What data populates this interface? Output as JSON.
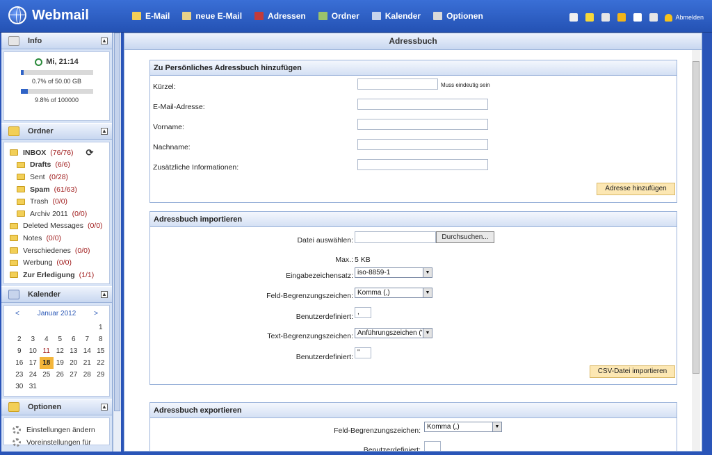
{
  "app": {
    "title": "Webmail"
  },
  "nav": [
    {
      "label": "E-Mail",
      "icon": "mail-icon",
      "color": "#f2cf57"
    },
    {
      "label": "neue E-Mail",
      "icon": "compose-icon",
      "color": "#e8d28a"
    },
    {
      "label": "Adressen",
      "icon": "addressbook-icon",
      "color": "#c23b3b"
    },
    {
      "label": "Ordner",
      "icon": "folder-icon",
      "color": "#9bc36b"
    },
    {
      "label": "Kalender",
      "icon": "calendar-icon",
      "color": "#c7d4ec"
    },
    {
      "label": "Optionen",
      "icon": "options-gear-icon",
      "color": "#d9d9d9"
    }
  ],
  "tools": [
    {
      "icon": "notes-icon",
      "color": "#f0f0f0"
    },
    {
      "icon": "sticky-note-icon",
      "color": "#f6d83a"
    },
    {
      "icon": "card-icon",
      "color": "#e6e6e6"
    },
    {
      "icon": "favorites-icon",
      "color": "#f2b51a"
    },
    {
      "icon": "help-icon",
      "color": "#ffffff"
    },
    {
      "icon": "search-icon",
      "color": "#e6e6e6"
    }
  ],
  "logout": "Abmelden",
  "sidebar": {
    "info": {
      "title": "Info",
      "time": "Mi, 21:14",
      "quota1": "0.7% of 50.00 GB",
      "quota1_pct": 0.7,
      "quota2": "9.8% of 100000",
      "quota2_pct": 9.8
    },
    "folders_title": "Ordner",
    "folders": [
      {
        "name": "INBOX",
        "count": "(76/76)",
        "bold": true
      },
      {
        "name": "Drafts",
        "count": "(6/6)",
        "bold": true
      },
      {
        "name": "Sent",
        "count": "(0/28)",
        "bold": false
      },
      {
        "name": "Spam",
        "count": "(61/63)",
        "bold": true
      },
      {
        "name": "Trash",
        "count": "(0/0)",
        "bold": false
      },
      {
        "name": "Archiv 2011",
        "count": "(0/0)",
        "bold": false
      },
      {
        "name": "Deleted Messages",
        "count": "(0/0)",
        "bold": false
      },
      {
        "name": "Notes",
        "count": "(0/0)",
        "bold": false
      },
      {
        "name": "Verschiedenes",
        "count": "(0/0)",
        "bold": false
      },
      {
        "name": "Werbung",
        "count": "(0/0)",
        "bold": false
      },
      {
        "name": "Zur Erledigung",
        "count": "(1/1)",
        "bold": true
      }
    ],
    "calendar": {
      "title": "Kalender",
      "prev": "<",
      "month": "Januar 2012",
      "next": ">",
      "days": [
        "",
        "",
        "",
        "",
        "",
        "",
        "1",
        "2",
        "3",
        "4",
        "5",
        "6",
        "7",
        "8",
        "9",
        "10",
        "11",
        "12",
        "13",
        "14",
        "15",
        "16",
        "17",
        "18",
        "19",
        "20",
        "21",
        "22",
        "23",
        "24",
        "25",
        "26",
        "27",
        "28",
        "29",
        "30",
        "31"
      ],
      "today": "18"
    },
    "options": {
      "title": "Optionen",
      "items": [
        "Einstellungen ändern",
        "Voreinstellungen für"
      ]
    }
  },
  "main": {
    "title": "Adressbuch",
    "add": {
      "title": "Zu Persönliches Adressbuch hinzufügen",
      "fields": [
        "Kürzel:",
        "E-Mail-Adresse:",
        "Vorname:",
        "Nachname:",
        "Zusätzliche Informationen:"
      ],
      "hint": "Muss eindeutig sein",
      "button": "Adresse hinzufügen"
    },
    "import": {
      "title": "Adressbuch importieren",
      "file_label": "Datei auswählen:",
      "browse": "Durchsuchen...",
      "max_label": "Max.:",
      "max_value": "5 KB",
      "charset_label": "Eingabezeichensatz:",
      "charset_value": "iso-8859-1",
      "field_sep_label": "Feld-Begrenzungszeichen:",
      "field_sep_value": "Komma (,)",
      "custom_label": "Benutzerdefiniert:",
      "custom_value": ",",
      "text_sep_label": "Text-Begrenzungszeichen:",
      "text_sep_value": "Anführungszeichen (\")",
      "custom2_label": "Benutzerdefiniert:",
      "custom2_value": "\"",
      "button": "CSV-Datei importieren"
    },
    "export": {
      "title": "Adressbuch exportieren",
      "field_sep_label": "Feld-Begrenzungszeichen:",
      "field_sep_value": "Komma (,)",
      "custom_label": "Benutzerdefiniert:"
    }
  }
}
